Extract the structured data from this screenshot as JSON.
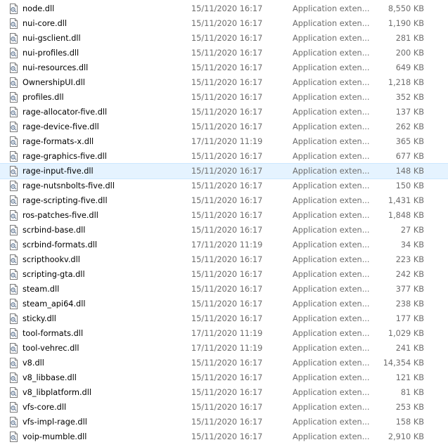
{
  "files": [
    {
      "name": "node.dll",
      "date": "15/11/2020 16:17",
      "type": "Application exten...",
      "size": "8,550 KB"
    },
    {
      "name": "nui-core.dll",
      "date": "15/11/2020 16:17",
      "type": "Application exten...",
      "size": "1,190 KB"
    },
    {
      "name": "nui-gsclient.dll",
      "date": "15/11/2020 16:17",
      "type": "Application exten...",
      "size": "281 KB"
    },
    {
      "name": "nui-profiles.dll",
      "date": "15/11/2020 16:17",
      "type": "Application exten...",
      "size": "200 KB"
    },
    {
      "name": "nui-resources.dll",
      "date": "15/11/2020 16:17",
      "type": "Application exten...",
      "size": "649 KB"
    },
    {
      "name": "OwnershipUI.dll",
      "date": "15/11/2020 16:17",
      "type": "Application exten...",
      "size": "1,218 KB"
    },
    {
      "name": "profiles.dll",
      "date": "15/11/2020 16:17",
      "type": "Application exten...",
      "size": "352 KB"
    },
    {
      "name": "rage-allocator-five.dll",
      "date": "15/11/2020 16:17",
      "type": "Application exten...",
      "size": "137 KB"
    },
    {
      "name": "rage-device-five.dll",
      "date": "15/11/2020 16:17",
      "type": "Application exten...",
      "size": "262 KB"
    },
    {
      "name": "rage-formats-x.dll",
      "date": "17/11/2020 11:19",
      "type": "Application exten...",
      "size": "365 KB"
    },
    {
      "name": "rage-graphics-five.dll",
      "date": "15/11/2020 16:17",
      "type": "Application exten...",
      "size": "677 KB"
    },
    {
      "name": "rage-input-five.dll",
      "date": "15/11/2020 16:17",
      "type": "Application exten...",
      "size": "148 KB",
      "selected": true
    },
    {
      "name": "rage-nutsnbolts-five.dll",
      "date": "15/11/2020 16:17",
      "type": "Application exten...",
      "size": "150 KB"
    },
    {
      "name": "rage-scripting-five.dll",
      "date": "15/11/2020 16:17",
      "type": "Application exten...",
      "size": "1,431 KB"
    },
    {
      "name": "ros-patches-five.dll",
      "date": "15/11/2020 16:17",
      "type": "Application exten...",
      "size": "1,848 KB"
    },
    {
      "name": "scrbind-base.dll",
      "date": "15/11/2020 16:17",
      "type": "Application exten...",
      "size": "27 KB"
    },
    {
      "name": "scrbind-formats.dll",
      "date": "17/11/2020 11:19",
      "type": "Application exten...",
      "size": "34 KB"
    },
    {
      "name": "scripthookv.dll",
      "date": "15/11/2020 16:17",
      "type": "Application exten...",
      "size": "223 KB"
    },
    {
      "name": "scripting-gta.dll",
      "date": "15/11/2020 16:17",
      "type": "Application exten...",
      "size": "242 KB"
    },
    {
      "name": "steam.dll",
      "date": "15/11/2020 16:17",
      "type": "Application exten...",
      "size": "377 KB"
    },
    {
      "name": "steam_api64.dll",
      "date": "15/11/2020 16:17",
      "type": "Application exten...",
      "size": "238 KB"
    },
    {
      "name": "sticky.dll",
      "date": "15/11/2020 16:17",
      "type": "Application exten...",
      "size": "177 KB"
    },
    {
      "name": "tool-formats.dll",
      "date": "17/11/2020 11:19",
      "type": "Application exten...",
      "size": "1,029 KB"
    },
    {
      "name": "tool-vehrec.dll",
      "date": "17/11/2020 11:19",
      "type": "Application exten...",
      "size": "241 KB"
    },
    {
      "name": "v8.dll",
      "date": "15/11/2020 16:17",
      "type": "Application exten...",
      "size": "14,354 KB"
    },
    {
      "name": "v8_libbase.dll",
      "date": "15/11/2020 16:17",
      "type": "Application exten...",
      "size": "121 KB"
    },
    {
      "name": "v8_libplatform.dll",
      "date": "15/11/2020 16:17",
      "type": "Application exten...",
      "size": "81 KB"
    },
    {
      "name": "vfs-core.dll",
      "date": "15/11/2020 16:17",
      "type": "Application exten...",
      "size": "253 KB"
    },
    {
      "name": "vfs-impl-rage.dll",
      "date": "15/11/2020 16:17",
      "type": "Application exten...",
      "size": "158 KB"
    },
    {
      "name": "voip-mumble.dll",
      "date": "15/11/2020 16:17",
      "type": "Application exten...",
      "size": "2,910 KB"
    }
  ],
  "icon": "dll-file-icon",
  "colors": {
    "selection_background": "#e5f3ff",
    "selection_border": "#cce8ff",
    "secondary_text": "#6d6d6d"
  }
}
